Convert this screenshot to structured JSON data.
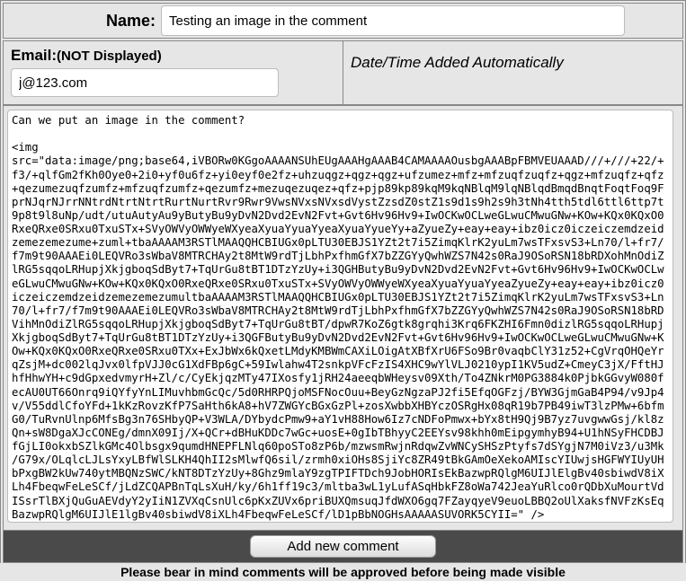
{
  "form": {
    "name_label": "Name:",
    "name_value": "Testing an image in the comment",
    "email_label": "Email:",
    "email_hint": "(NOT Displayed)",
    "email_value": "j@123.com",
    "datetime_label": "Date/Time Added Automatically",
    "comment_value": "Can we put an image in the comment?\n\n<img src=\"data:image/png;base64,iVBORw0KGgoAAAANSUhEUgAAAHgAAAB4CAMAAAAOusbgAAABpFBMVEUAAAD///+///+22/+f3/+qlfGm2fKh0Oye0+2i0+yf0u6fz+yi0eyf0e2fz+uhzuqgz+qgz+qgz+ufzumez+mfz+mfzuqfzuqfz+qgz+mfzuqfz+qfz+qezumezuqfzumfz+mfzuqfzumfz+qezumfz+mezuqezuqez+qfz+pjp89kp89kqM9kqNBlqM9lqNBlqdBmqdBnqtFoqtFoq9FprNJqrNJrrNNtrdNtrtNtrtRurtNurtRvr9Rwr9VwsNVxsNVxsdVystZzsdZ0stZ1s9d1s9h2s9h3tNh4tth5tdl6ttl6ttp7t9p8t9l8uNp/udt/utuAutyAu9yButyBu9yDvN2Dvd2EvN2Fvt+Gvt6Hv96Hv9+IwOCKwOCLweGLwuCMwuGNw+KOw+KQx0KQxO0RxeQRxe0SRxu0TxuSTx+SVyOWVyOWWyeWXyeaXyuaYyuaYyeaXyuaYyueYy+aZyueZy+eay+eay+ibz0icz0iczeiczemdzeidzemezemezume+zuml+tbaAAAAM3RSTlMAAQQHCBIUGx0pLTU30EBJS1YZt2t7i5ZimqKlrK2yuLm7wsTFxsvS3+Ln70/l+fr7/f7m9t90AAAEi0LEQVRo3sWbaV8MTRCHAy2t8MtW9rdTjLbhPxfhmGfX7bZZGYyQwhWZS7N42s0RaJ9OSoRSN18bRDXohMnOdiZlRG5sqqoLRHupjXkjgboqSdByt7+TqUrGu8tBT1DTzYzUy+i3QGHButyBu9yDvN2Dvd2EvN2Fvt+Gvt6Hv96Hv9+IwOCKwOCLweGLwuCMwuGNw+KOw+KQx0KQxO0RxeQRxe0SRxu0TxuSTx+SVyOWVyOWWyeWXyeaXyuaYyuaYyeaZyueZy+eay+eay+ibz0icz0iczeiczemdzeidzemezemezumultbaAAAAM3RSTlMAAQQHCBIUGx0pLTU30EBJS1YZt2t7i5ZimqKlrK2yuLm7wsTFxsvS3+Ln70/l+fr7/f7m9t90AAAEi0LEQVRo3sWbaV8MTRCHAy2t8MtW9rdTjLbhPxfhmGfX7bZZGYyQwhWZS7N42s0RaJ9OSoRSN18bRDVihMnOdiZlRG5sqqoLRHupjXkjgboqSdByt7+TqUrGu8tBT/dpwR7KoZ6gtk8grqhi3Krq6FKZHI6Fmn0dizlRG5sqqoLRHupjXkjgboqSdByt7+TqUrGu8tBT1DTzYzUy+i3QGFButyBu9yDvN2Dvd2EvN2Fvt+Gvt6Hv96Hv9+IwOCKwOCLweGLwuCMwuGNw+KOw+KQx0KQxO0RxeQRxe0SRxu0TXx+ExJbWx6kQxetLMdyKMBWmCAXiLOigAtXBfXrU6FSo9Br0vaqbClY31z52+CgVrqOHQeYrqZsjM+dc002lqJvx0lfpVJJ0cG1XdFBp6gC+59Iwlahw4T2snkpVFcFzIS4XHC9wYlVLJ0210ypI1KV5udZ+CmeyC3jX/FftHJhfHhwYH+c9dGpxedvmyrH+Zl/c/CyEkjqzMTy47IXosfy1jRH24aeeqbWHeysv09Xth/To4ZNkrM0PG3884k0PjbkGGvyW080fecAU0UT66Onrq9iQYfyYnLIMuvhbmGcQc/5d0RHRPQjoMSFNocOuu+BeyGzNgzaPJ2fi5EfqOGFzj/BYW3GjmGaB4P94/v9Jp4v/V55ddlCfoYFd+1kKzRovzKfP7SaHth6kA8+hV7ZWGYcBGxGzPl+zosXwbbXHBYczOSRgHx08qR19b7PB49iwT3lzPMw+6bfmG0/TuRvnUlnp6MfsBg3n76SHbyQP+V3WLA/DYbydcPmw9+aY1vH88How6Iz7cNDFoPmwx+bYx8tH9Qj9B7yz7uvgwwGsj/kl8zQn+sW8DgaXJcCONEg/dmnX09Ij/X+QCr+dBHuKDDc7wGc+uosE+0gIbTBhyyC2EEYsv98khh0mEipgymhyB94+U1hNSyFHCDBJfGjLI0okxbSZlkGMc4Olbsgx9qumdHNEPFLNlq60poSTo8zP6b/mzwsmRwjnRdqwZvWNCySHSzPtyfs7dSYgjN7M0iVz3/u3Mk/G79x/OLqlcLJLsYxyLBfWlSLKH4QhII2sMlwfQ6sil/zrmh0xiOHs8SjiYc8ZR49tBkGAmOeXekoAMIscYIUwjsHGFWYIUyUHbPxgBW2kUw740ytMBQNzSWC/kNT8DTzYzUy+8Ghz9mlaY9zgTPIFTDch9JobHORIsEkBazwpRQlgM6UIJlElgBv40sbiwdV8iXLh4FbeqwFeLeSCf/jLdZCQAPBnTqLsXuH/ky/6h1ff19c3/mltba3wL1yLufASqHbkFZ8oWa742JeaYuRlco0rQDbXuMourtVdISsrTlBXjQuGuAEVdyY2yIiN1ZVXqCsnUlc6pKxZUVx6priBUXQmsuqJfdWXO6gq7FZayqyeV9euoLBBQ2oUlXaksfNVFzKsEqBazwpRQlgM6UIJlE1lgBv40sbiwdV8iXLh4FbeqwFeLeSCf/lD1pBbNOGHsAAAAASUVORK5CYII=\" />",
    "submit_label": "Add new comment",
    "footer_text": "Please bear in mind comments will be approved before being made visible"
  }
}
